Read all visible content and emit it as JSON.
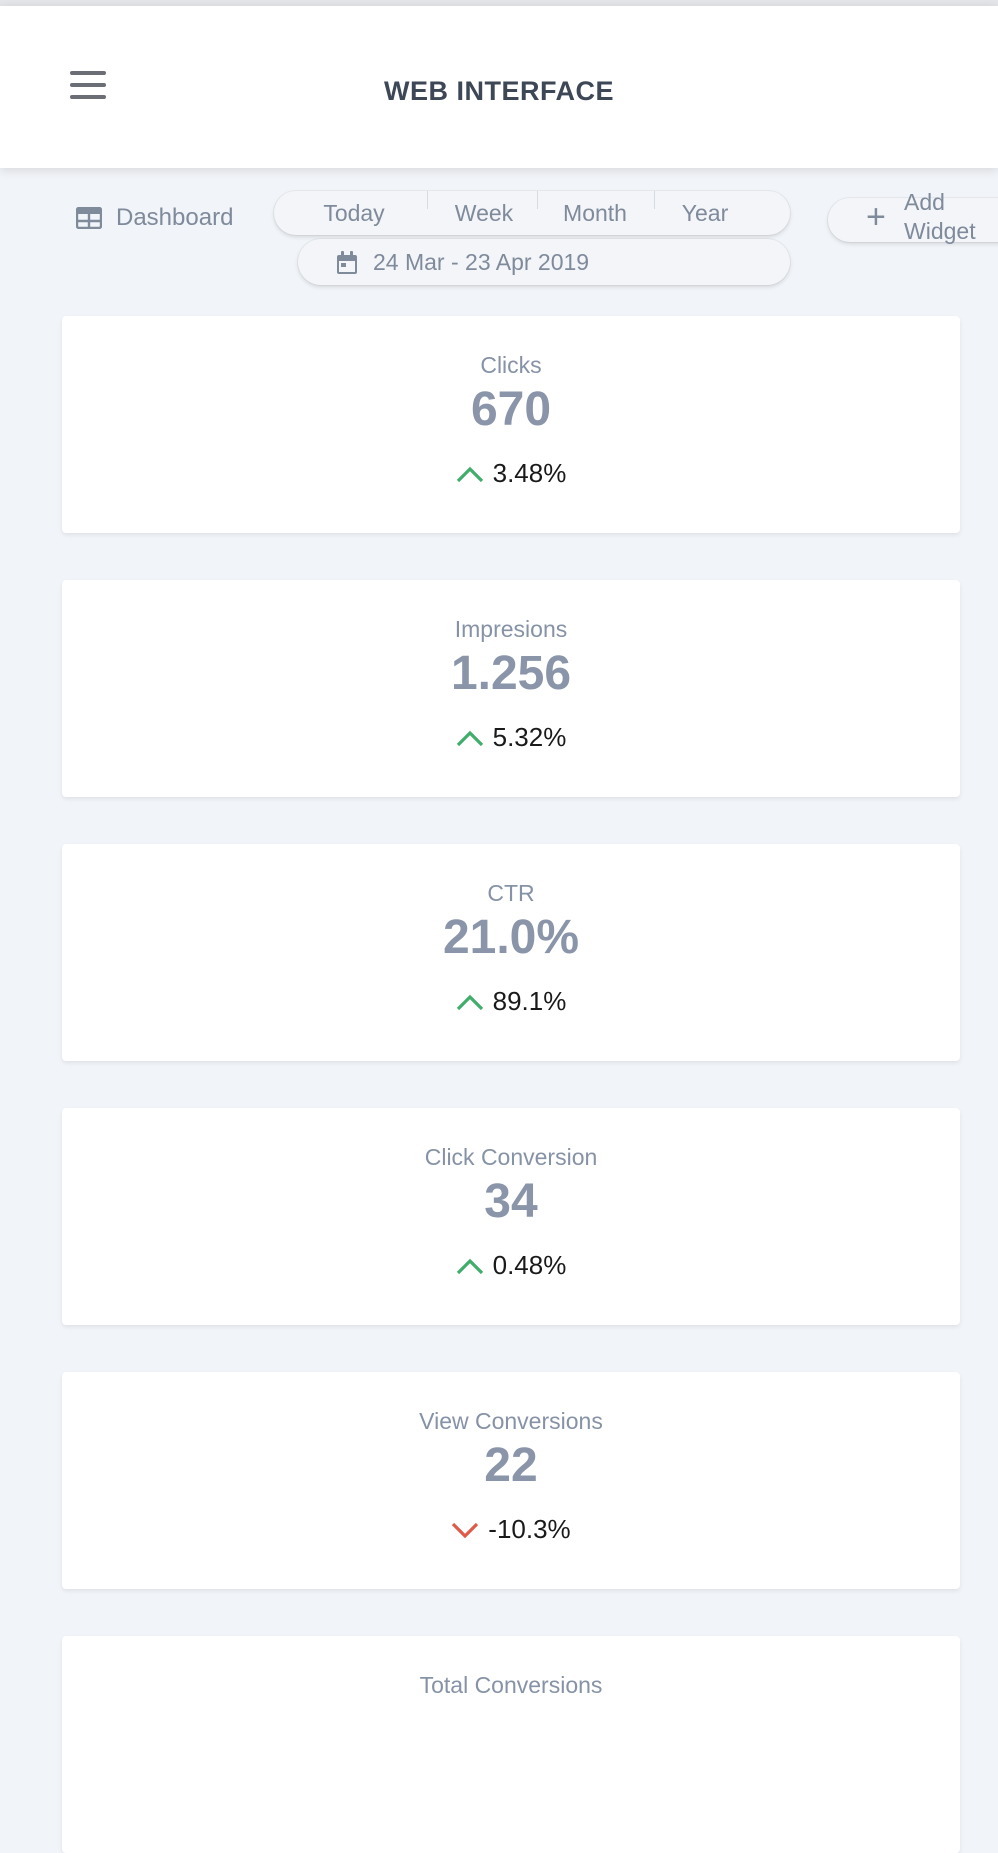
{
  "header": {
    "title": "WEB INTERFACE"
  },
  "toolbar": {
    "dashboard_label": "Dashboard",
    "periods": [
      "Today",
      "Week",
      "Month",
      "Year"
    ],
    "date_range": "24 Mar - 23 Apr 2019",
    "add_widget_label": "Add Widget"
  },
  "cards": [
    {
      "title": "Clicks",
      "value": "670",
      "delta": "3.48%",
      "trend": "up"
    },
    {
      "title": "Impresions",
      "value": "1.256",
      "delta": "5.32%",
      "trend": "up"
    },
    {
      "title": "CTR",
      "value": "21.0%",
      "delta": "89.1%",
      "trend": "up"
    },
    {
      "title": "Click Conversion",
      "value": "34",
      "delta": "0.48%",
      "trend": "up"
    },
    {
      "title": "View Conversions",
      "value": "22",
      "delta": "-10.3%",
      "trend": "down"
    },
    {
      "title": "Total Conversions",
      "value": "",
      "delta": "",
      "trend": ""
    }
  ],
  "colors": {
    "up": "#3fae6a",
    "down": "#e05a47",
    "muted": "#7f8a9b",
    "background": "#f1f4f8"
  },
  "icons": [
    "menu-icon",
    "table-icon",
    "calendar-icon",
    "plus-icon",
    "arrow-up-icon",
    "arrow-down-icon"
  ]
}
